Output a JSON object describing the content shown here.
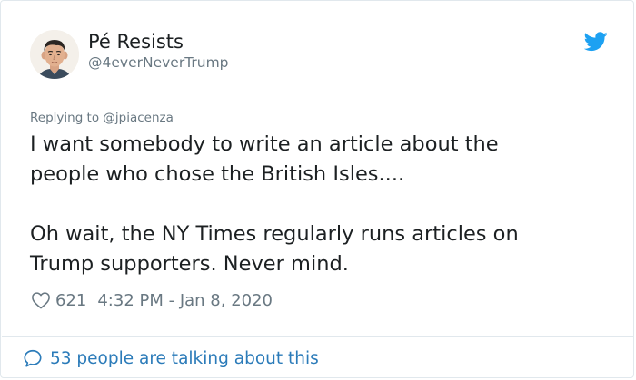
{
  "user": {
    "display_name": "Pé Resists",
    "handle": "@4everNeverTrump"
  },
  "reply": {
    "text": "Replying to @jpiacenza"
  },
  "tweet": {
    "line1": "I want somebody to write an article about the",
    "line2": "people who chose the British Isles....",
    "line3": "Oh wait, the NY Times regularly runs articles on",
    "line4": "Trump supporters. Never mind."
  },
  "meta": {
    "likes": "621",
    "timestamp": "4:32 PM - Jan 8, 2020"
  },
  "footer": {
    "talking": "53 people are talking about this"
  },
  "colors": {
    "twitter_blue": "#1da1f2",
    "link_blue": "#2b7bb9",
    "muted_gray": "#697882",
    "text": "#1c2022"
  },
  "icons": {
    "brand": "twitter-bird-icon",
    "like": "heart-outline-icon",
    "conversation": "speech-bubble-icon"
  }
}
